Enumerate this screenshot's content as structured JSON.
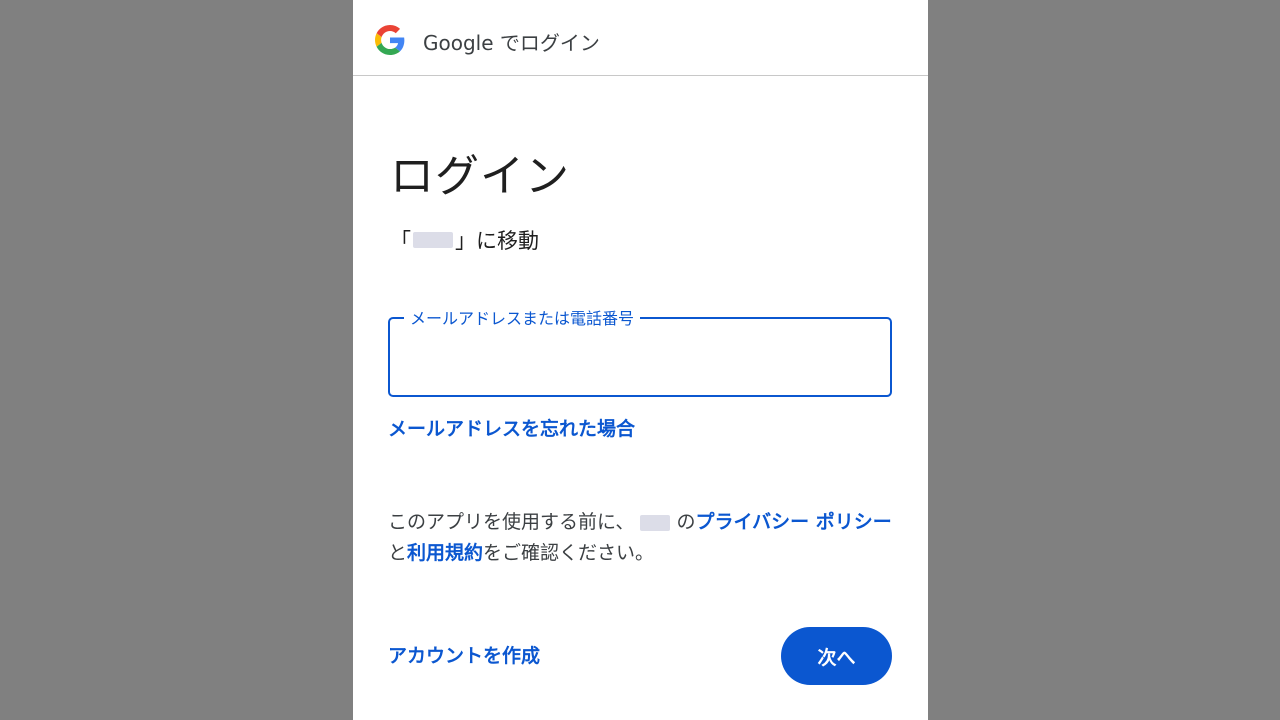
{
  "header": {
    "title": "Google でログイン",
    "logo": "google-g-logo"
  },
  "main": {
    "heading": "ログイン",
    "destination_prefix": "「",
    "destination_suffix": "」に移動"
  },
  "email_field": {
    "label": "メールアドレスまたは電話番号",
    "value": ""
  },
  "links": {
    "forgot_email": "メールアドレスを忘れた場合",
    "create_account": "アカウントを作成"
  },
  "notice": {
    "part1": "このアプリを使用する前に、",
    "part2": "の",
    "privacy_policy": "プライバシー ポリシー",
    "part3": "と",
    "terms": "利用規約",
    "part4": "をご確認ください。"
  },
  "buttons": {
    "next": "次へ"
  },
  "colors": {
    "accent": "#0b57d0",
    "backdrop": "#808080"
  }
}
